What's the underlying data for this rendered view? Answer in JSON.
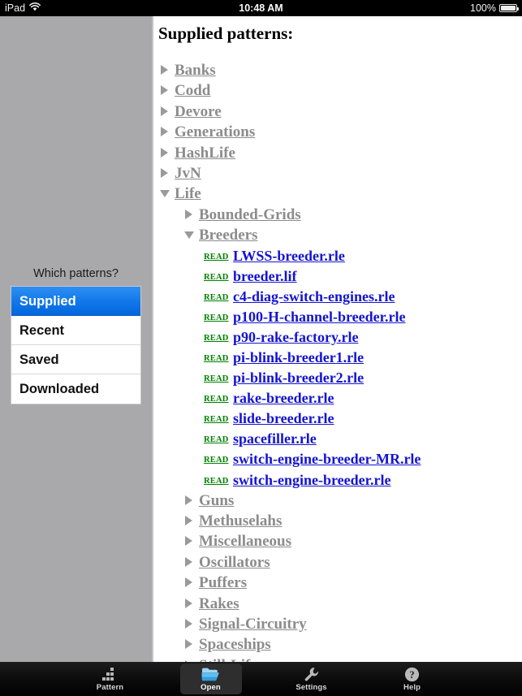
{
  "status_bar": {
    "device": "iPad",
    "wifi_icon": "wifi-icon",
    "time": "10:48 AM",
    "battery_percent": "100%",
    "battery_icon": "battery-full-icon"
  },
  "sidebar": {
    "picker_label": "Which patterns?",
    "options": [
      {
        "label": "Supplied",
        "selected": true
      },
      {
        "label": "Recent",
        "selected": false
      },
      {
        "label": "Saved",
        "selected": false
      },
      {
        "label": "Downloaded",
        "selected": false
      }
    ],
    "selected_value": "Supplied",
    "background_color": "#a9a9ac",
    "selected_color": "#1279ea"
  },
  "content": {
    "title": "Supplied patterns:",
    "folder_color": "#8c8c8c",
    "file_link_color": "#1414d0",
    "read_link_color": "#008000",
    "read_label": "READ",
    "tree": [
      {
        "label": "Banks",
        "level": 1,
        "expanded": false,
        "arrow": "triangle-right-icon"
      },
      {
        "label": "Codd",
        "level": 1,
        "expanded": false,
        "arrow": "triangle-right-icon"
      },
      {
        "label": "Devore",
        "level": 1,
        "expanded": false,
        "arrow": "triangle-right-icon"
      },
      {
        "label": "Generations",
        "level": 1,
        "expanded": false,
        "arrow": "triangle-right-icon"
      },
      {
        "label": "HashLife",
        "level": 1,
        "expanded": false,
        "arrow": "triangle-right-icon"
      },
      {
        "label": "JvN",
        "level": 1,
        "expanded": false,
        "arrow": "triangle-right-icon"
      },
      {
        "label": "Life",
        "level": 1,
        "expanded": true,
        "arrow": "triangle-down-icon"
      },
      {
        "label": "Bounded-Grids",
        "level": 2,
        "expanded": false,
        "arrow": "triangle-right-icon"
      },
      {
        "label": "Breeders",
        "level": 2,
        "expanded": true,
        "arrow": "triangle-down-icon"
      }
    ],
    "files": [
      "LWSS-breeder.rle",
      "breeder.lif",
      "c4-diag-switch-engines.rle",
      "p100-H-channel-breeder.rle",
      "p90-rake-factory.rle",
      "pi-blink-breeder1.rle",
      "pi-blink-breeder2.rle",
      "rake-breeder.rle",
      "slide-breeder.rle",
      "spacefiller.rle",
      "switch-engine-breeder-MR.rle",
      "switch-engine-breeder.rle"
    ],
    "tree_after": [
      {
        "label": "Guns",
        "level": 2,
        "expanded": false,
        "arrow": "triangle-right-icon"
      },
      {
        "label": "Methuselahs",
        "level": 2,
        "expanded": false,
        "arrow": "triangle-right-icon"
      },
      {
        "label": "Miscellaneous",
        "level": 2,
        "expanded": false,
        "arrow": "triangle-right-icon"
      },
      {
        "label": "Oscillators",
        "level": 2,
        "expanded": false,
        "arrow": "triangle-right-icon"
      },
      {
        "label": "Puffers",
        "level": 2,
        "expanded": false,
        "arrow": "triangle-right-icon"
      },
      {
        "label": "Rakes",
        "level": 2,
        "expanded": false,
        "arrow": "triangle-right-icon"
      },
      {
        "label": "Signal-Circuitry",
        "level": 2,
        "expanded": false,
        "arrow": "triangle-right-icon"
      },
      {
        "label": "Spaceships",
        "level": 2,
        "expanded": false,
        "arrow": "triangle-right-icon"
      },
      {
        "label": "Still-Lifes",
        "level": 2,
        "expanded": false,
        "arrow": "triangle-right-icon"
      }
    ]
  },
  "toolbar": {
    "tabs": [
      {
        "label": "Pattern",
        "icon": "pattern-grid-icon",
        "active": false
      },
      {
        "label": "Open",
        "icon": "folder-open-icon",
        "active": true
      },
      {
        "label": "Settings",
        "icon": "wrench-icon",
        "active": false
      },
      {
        "label": "Help",
        "icon": "question-mark-circle-icon",
        "active": false
      }
    ]
  }
}
